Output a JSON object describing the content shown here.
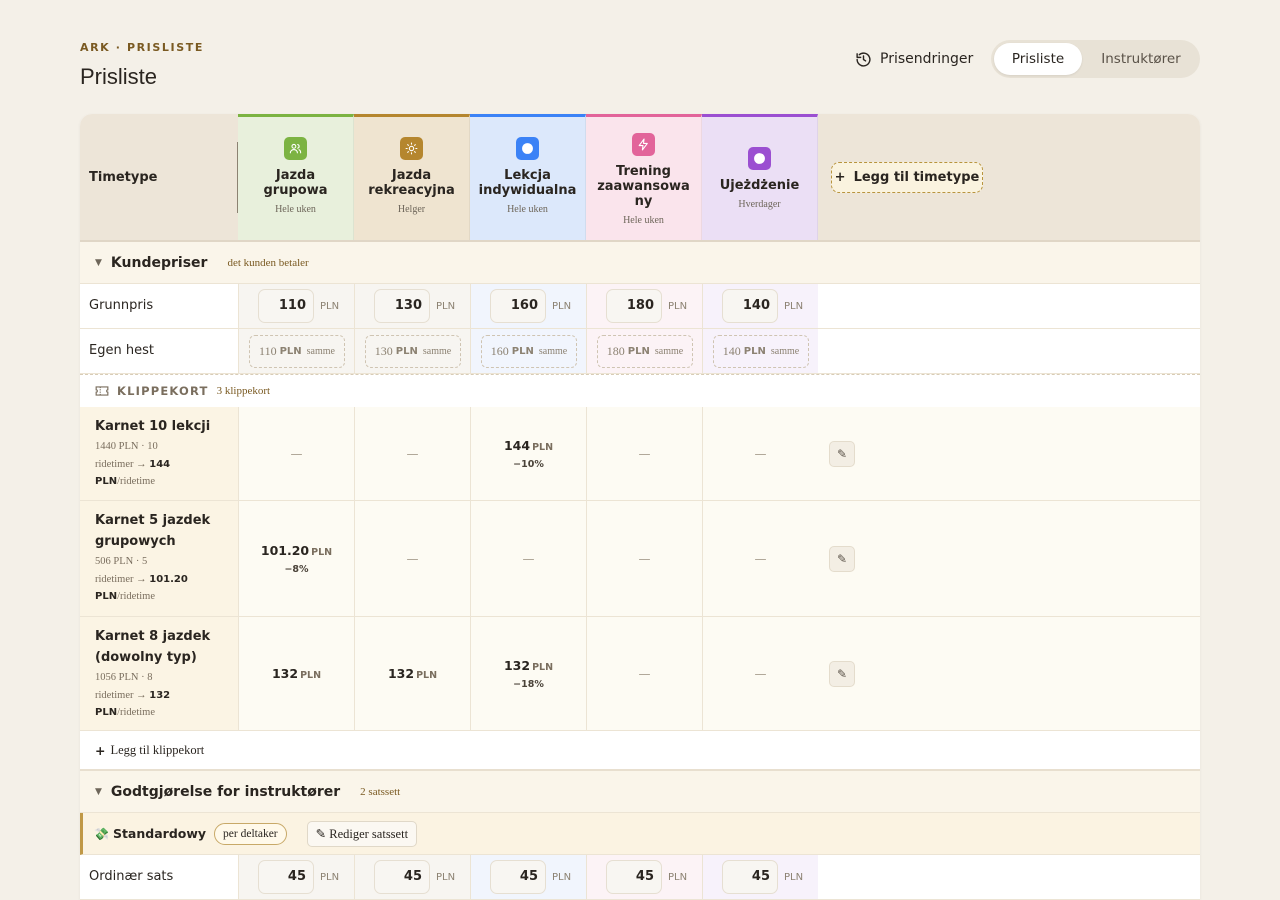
{
  "header": {
    "breadcrumb": "ARK · PRISLISTE",
    "title": "Prisliste",
    "history_label": "Prisendringer",
    "tabs": [
      {
        "label": "Prisliste",
        "active": true
      },
      {
        "label": "Instruktører",
        "active": false
      }
    ]
  },
  "columns_header": {
    "label": "Timetype",
    "add_label": "Legg til timetype"
  },
  "columns": [
    {
      "name_line1": "Jazda",
      "name_line2": "grupowa",
      "name_line3": "",
      "schedule": "Hele uken",
      "color": "#7cb342",
      "icon": "people-icon"
    },
    {
      "name_line1": "Jazda",
      "name_line2": "rekreacyjna",
      "name_line3": "",
      "schedule": "Helger",
      "color": "#b5862e",
      "icon": "sun-icon"
    },
    {
      "name_line1": "Lekcja",
      "name_line2": "indywidualna",
      "name_line3": "",
      "schedule": "Hele uken",
      "color": "#3b82f6",
      "icon": "circle-icon"
    },
    {
      "name_line1": "Trening",
      "name_line2": "zaawansowa",
      "name_line3": "ny",
      "schedule": "Hele uken",
      "color": "#e2649a",
      "icon": "bolt-icon"
    },
    {
      "name_line1": "Ujeżdżenie",
      "name_line2": "",
      "name_line3": "",
      "schedule": "Hverdager",
      "color": "#9b4fd1",
      "icon": "circle-icon"
    }
  ],
  "customer_section": {
    "title": "Kundepriser",
    "note": "det kunden betaler",
    "base_row": {
      "label": "Grunnpris",
      "values": [
        "110",
        "130",
        "160",
        "180",
        "140"
      ],
      "unit": "PLN"
    },
    "own_horse_row": {
      "label": "Egen hest",
      "values": [
        "110",
        "130",
        "160",
        "180",
        "140"
      ],
      "unit": "PLN",
      "same_label": "samme"
    }
  },
  "punch_cards": {
    "title": "KLIPPEKORT",
    "count": "3 klippekort",
    "unit": "PLN",
    "per_label": "/ridetime",
    "rows": [
      {
        "name_line1": "Karnet 10 lekcji",
        "name_line2": "",
        "calc": "1440 PLN · 10",
        "calc2": "ridetimer →",
        "per_value": "144",
        "per_unit": "PLN",
        "cells": [
          {
            "value": "",
            "pct": ""
          },
          {
            "value": "",
            "pct": ""
          },
          {
            "value": "144",
            "pct": "−10%"
          },
          {
            "value": "",
            "pct": ""
          },
          {
            "value": "",
            "pct": ""
          }
        ]
      },
      {
        "name_line1": "Karnet 5 jazdek",
        "name_line2": "grupowych",
        "calc": "506 PLN · 5",
        "calc2": "ridetimer →",
        "per_value": "101.20",
        "per_unit": "PLN",
        "cells": [
          {
            "value": "101.20",
            "pct": "−8%"
          },
          {
            "value": "",
            "pct": ""
          },
          {
            "value": "",
            "pct": ""
          },
          {
            "value": "",
            "pct": ""
          },
          {
            "value": "",
            "pct": ""
          }
        ]
      },
      {
        "name_line1": "Karnet 8 jazdek",
        "name_line2": "(dowolny typ)",
        "calc": "1056 PLN · 8",
        "calc2": "ridetimer →",
        "per_value": "132",
        "per_unit": "PLN",
        "cells": [
          {
            "value": "132",
            "pct": ""
          },
          {
            "value": "132",
            "pct": ""
          },
          {
            "value": "132",
            "pct": "−18%"
          },
          {
            "value": "",
            "pct": ""
          },
          {
            "value": "",
            "pct": ""
          }
        ]
      }
    ],
    "empty_mark": "—",
    "add_label": "Legg til klippekort"
  },
  "instructor_section": {
    "title": "Godtgjørelse for instruktører",
    "note": "2 satssett",
    "rate_set": {
      "emoji": "💸",
      "name": "Standardowy",
      "pill": "per deltaker",
      "edit_label": "✎ Rediger satssett"
    },
    "ordinary_row": {
      "label": "Ordinær sats",
      "values": [
        "45",
        "45",
        "45",
        "45",
        "45"
      ],
      "unit": "PLN"
    }
  },
  "colors": {
    "col_tints": [
      "#e8f0dc",
      "#efe4d0",
      "#dce8fb",
      "#fae4ec",
      "#ebdff5"
    ],
    "row_tints": [
      "#f7f5f1",
      "#f7f5f1",
      "#f1f5fd",
      "#fcf3f6",
      "#f7f2fb"
    ],
    "accent": "#7a5a22"
  }
}
